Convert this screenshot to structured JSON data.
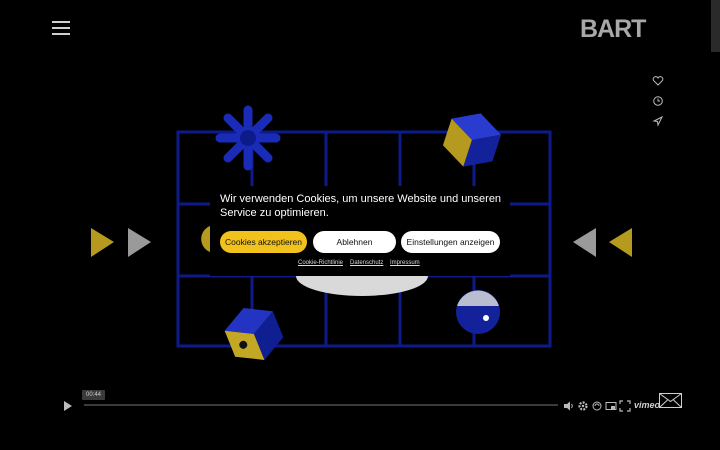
{
  "header": {
    "logo_text": "BART",
    "menu_icon": "hamburger-menu-icon"
  },
  "side_icons": [
    "heart-icon",
    "clock-icon",
    "send-icon"
  ],
  "player": {
    "time": "00:44",
    "vimeo_label": "vimeo",
    "progress": 0.0,
    "controls": [
      "play-icon",
      "volume-icon",
      "settings-icon",
      "airplay-icon",
      "pip-icon",
      "fullscreen-icon"
    ]
  },
  "cookie_banner": {
    "message": "Wir verwenden Cookies, um unsere Website und unseren Service zu optimieren.",
    "accept_label": "Cookies akzeptieren",
    "reject_label": "Ablehnen",
    "settings_label": "Einstellungen anzeigen",
    "links": [
      "Cookie-Richtlinie",
      "Datenschutz",
      "Impressum"
    ]
  },
  "colors": {
    "accent_yellow": "#f1c21b",
    "art_blue": "#0d1b8a",
    "art_yellow": "#b59a1f",
    "background": "#000000"
  }
}
